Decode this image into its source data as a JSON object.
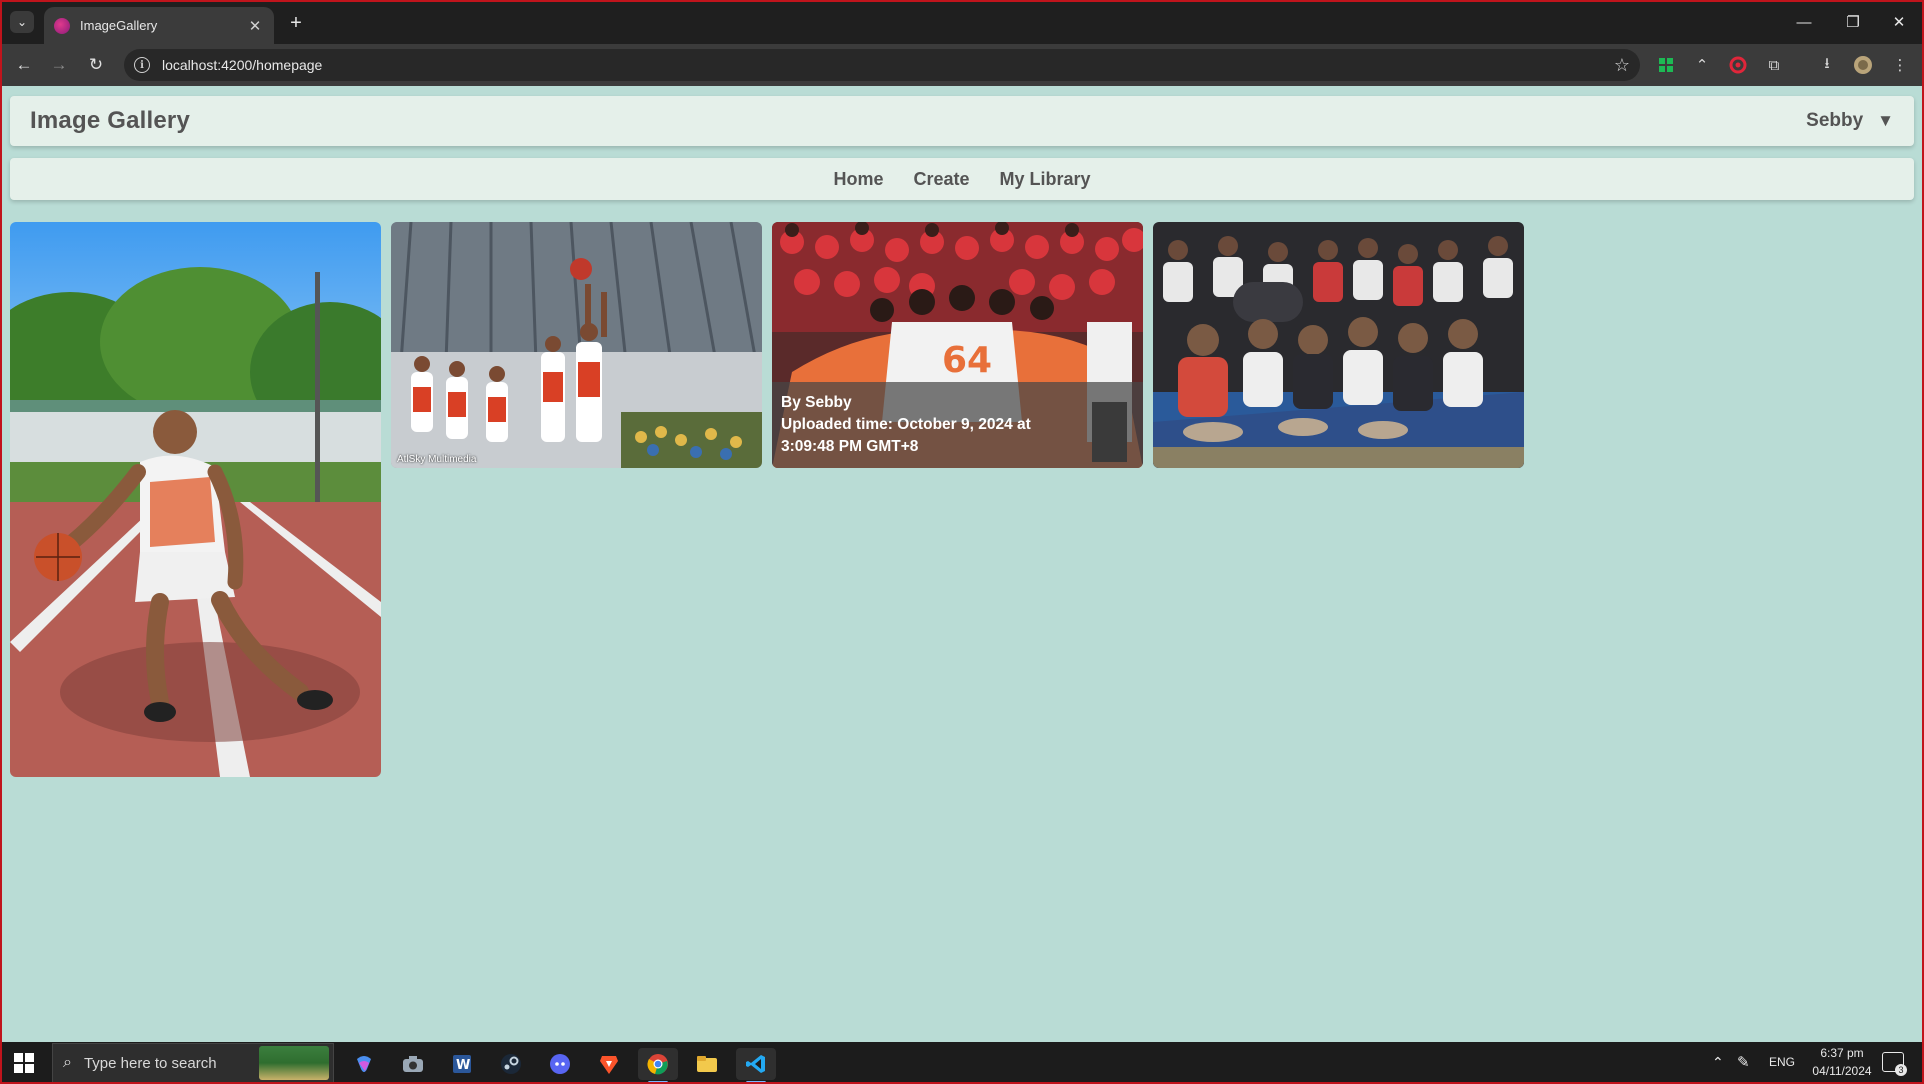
{
  "browser": {
    "tab_title": "ImageGallery",
    "tab_close": "✕",
    "new_tab": "+",
    "url": "localhost:4200/homepage",
    "window": {
      "minimize": "—",
      "restore": "❐",
      "close": "✕"
    }
  },
  "app": {
    "title": "Image Gallery",
    "user_name": "Sebby",
    "user_caret": "▼",
    "nav": [
      "Home",
      "Create",
      "My Library"
    ]
  },
  "gallery": {
    "cards": [
      {
        "kind": "player-dribbling"
      },
      {
        "kind": "free-throw",
        "watermark": "AtlSky Multimedia"
      },
      {
        "kind": "team-huddle",
        "author": "By Sebby",
        "uploaded_line1": "Uploaded time: October 9, 2024 at",
        "uploaded_line2": "3:09:48 PM GMT+8"
      },
      {
        "kind": "crowd-seated"
      }
    ]
  },
  "taskbar": {
    "search_placeholder": "Type here to search",
    "apps": [
      "copilot-icon",
      "camera-icon",
      "word-icon",
      "steam-icon",
      "discord-icon",
      "brave-icon",
      "chrome-icon",
      "file-explorer-icon",
      "vscode-icon"
    ],
    "active_app": "chrome-icon",
    "language": "ENG",
    "time": "6:37 pm",
    "date": "04/11/2024",
    "notifications": "3"
  },
  "colors": {
    "page_bg": "#b9dcd5",
    "panel_bg": "#e5f0ea",
    "text": "#545454",
    "window_border": "#c0141c"
  }
}
